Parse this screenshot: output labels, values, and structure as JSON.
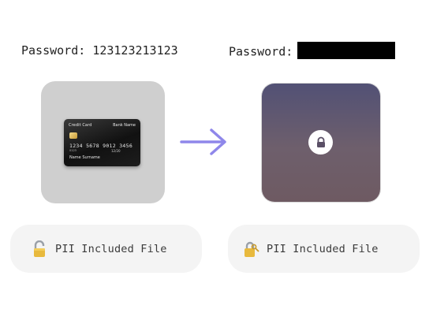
{
  "left": {
    "password_label": "Password:",
    "password_value": "123123213123",
    "card": {
      "title": "Credit Card",
      "bank": "Bank Name",
      "number": "1234 5678 9012 3456",
      "small_code": "0123",
      "expiry": "12/20",
      "holder": "Name Surname"
    },
    "file_label": "PII Included File",
    "file_icon": "open-padlock-icon"
  },
  "right": {
    "password_label": "Password:",
    "password_redacted": true,
    "file_label": "PII Included File",
    "file_icon": "locked-padlock-icon"
  },
  "colors": {
    "arrow": "#8f87ea",
    "encrypted_tile_top": "#525175",
    "encrypted_tile_bottom": "#6e5a62",
    "redaction": "#000000"
  }
}
